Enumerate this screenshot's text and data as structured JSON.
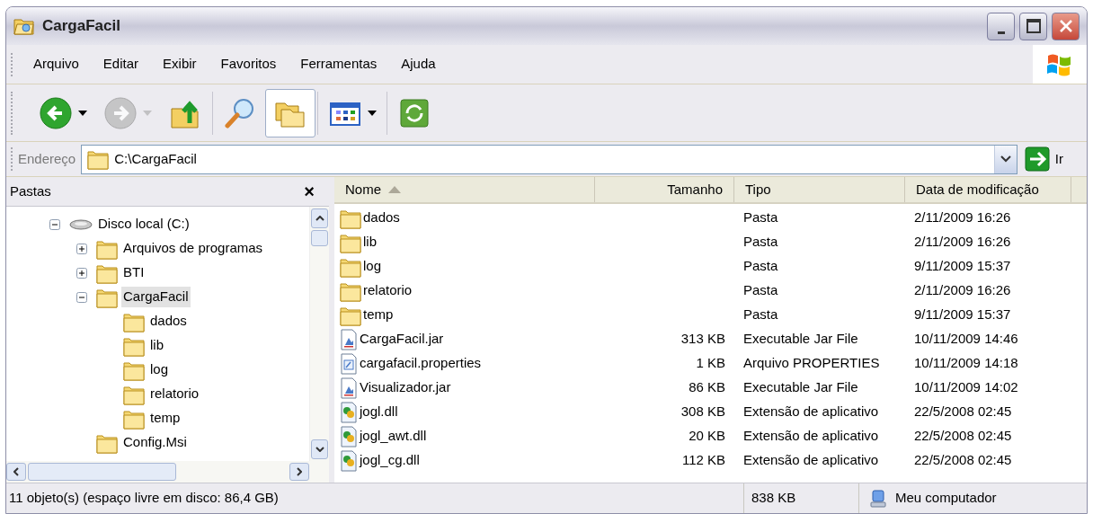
{
  "window": {
    "title": "CargaFacil"
  },
  "menu": [
    "Arquivo",
    "Editar",
    "Exibir",
    "Favoritos",
    "Ferramentas",
    "Ajuda"
  ],
  "toolbar": [
    {
      "kind": "back",
      "disabled": false,
      "selected": false
    },
    {
      "kind": "forward",
      "disabled": true,
      "selected": false
    },
    {
      "kind": "up",
      "disabled": false,
      "selected": false
    },
    {
      "kind": "search",
      "disabled": false,
      "selected": false
    },
    {
      "kind": "folders",
      "disabled": false,
      "selected": true
    },
    {
      "kind": "views",
      "disabled": false,
      "selected": false
    },
    {
      "kind": "sync",
      "disabled": false,
      "selected": false
    }
  ],
  "address": {
    "label": "Endereço",
    "value": "C:\\CargaFacil",
    "go": "Ir"
  },
  "folders_pane": {
    "title": "Pastas",
    "close": "×",
    "tree": [
      {
        "label": "Disco local (C:)",
        "kind": "drive",
        "expanded": true,
        "selected": false,
        "children": [
          {
            "label": "Arquivos de programas",
            "kind": "folder",
            "expanded": false,
            "selected": false
          },
          {
            "label": "BTI",
            "kind": "folder",
            "expanded": false,
            "selected": false
          },
          {
            "label": "CargaFacil",
            "kind": "folder",
            "expanded": true,
            "selected": true,
            "children": [
              {
                "label": "dados",
                "kind": "folder",
                "selected": false
              },
              {
                "label": "lib",
                "kind": "folder",
                "selected": false
              },
              {
                "label": "log",
                "kind": "folder",
                "selected": false
              },
              {
                "label": "relatorio",
                "kind": "folder",
                "selected": false
              },
              {
                "label": "temp",
                "kind": "folder",
                "selected": false
              }
            ]
          },
          {
            "label": "Config.Msi",
            "kind": "folder",
            "selected": false
          }
        ]
      }
    ]
  },
  "file_list": {
    "columns": [
      {
        "label": "Nome",
        "sorted": true
      },
      {
        "label": "Tamanho",
        "sorted": false
      },
      {
        "label": "Tipo",
        "sorted": false
      },
      {
        "label": "Data de modificação",
        "sorted": false
      }
    ],
    "rows": [
      {
        "kind": "folder",
        "name": "dados",
        "size": "",
        "type": "Pasta",
        "modified": "2/11/2009 16:26"
      },
      {
        "kind": "folder",
        "name": "lib",
        "size": "",
        "type": "Pasta",
        "modified": "2/11/2009 16:26"
      },
      {
        "kind": "folder",
        "name": "log",
        "size": "",
        "type": "Pasta",
        "modified": "9/11/2009 15:37"
      },
      {
        "kind": "folder",
        "name": "relatorio",
        "size": "",
        "type": "Pasta",
        "modified": "2/11/2009 16:26"
      },
      {
        "kind": "folder",
        "name": "temp",
        "size": "",
        "type": "Pasta",
        "modified": "9/11/2009 15:37"
      },
      {
        "kind": "jar",
        "name": "CargaFacil.jar",
        "size": "313 KB",
        "type": "Executable Jar File",
        "modified": "10/11/2009 14:46"
      },
      {
        "kind": "properties",
        "name": "cargafacil.properties",
        "size": "1 KB",
        "type": "Arquivo PROPERTIES",
        "modified": "10/11/2009 14:18"
      },
      {
        "kind": "jar",
        "name": "Visualizador.jar",
        "size": "86 KB",
        "type": "Executable Jar File",
        "modified": "10/11/2009 14:02"
      },
      {
        "kind": "dll",
        "name": "jogl.dll",
        "size": "308 KB",
        "type": "Extensão de aplicativo",
        "modified": "22/5/2008 02:45"
      },
      {
        "kind": "dll",
        "name": "jogl_awt.dll",
        "size": "20 KB",
        "type": "Extensão de aplicativo",
        "modified": "22/5/2008 02:45"
      },
      {
        "kind": "dll",
        "name": "jogl_cg.dll",
        "size": "112 KB",
        "type": "Extensão de aplicativo",
        "modified": "22/5/2008 02:45"
      }
    ]
  },
  "status_bar": {
    "objects": "11 objeto(s) (espaço livre em disco: 86,4 GB)",
    "size": "838 KB",
    "location": "Meu computador"
  }
}
